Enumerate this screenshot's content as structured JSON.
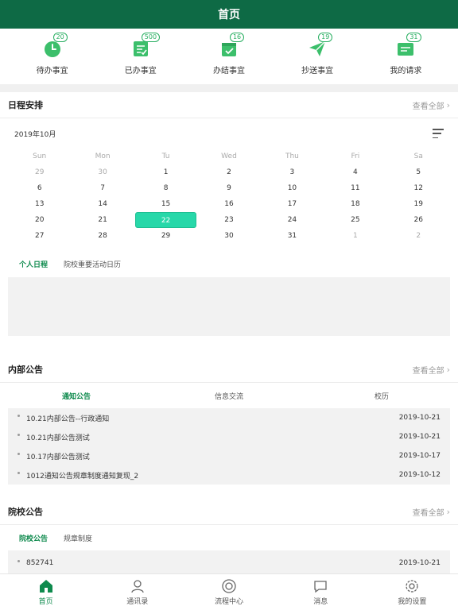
{
  "header": {
    "title": "首页"
  },
  "quick_actions": [
    {
      "label": "待办事宜",
      "badge": "20",
      "icon": "clock-icon"
    },
    {
      "label": "已办事宜",
      "badge": "500",
      "icon": "done-list-icon"
    },
    {
      "label": "办结事宜",
      "badge": "16",
      "icon": "calendar-check-icon"
    },
    {
      "label": "抄送事宜",
      "badge": "19",
      "icon": "send-icon"
    },
    {
      "label": "我的请求",
      "badge": "31",
      "icon": "request-icon"
    }
  ],
  "schedule": {
    "title": "日程安排",
    "more": "查看全部",
    "month": "2019年10月",
    "weekdays": [
      "Sun",
      "Mon",
      "Tu",
      "Wed",
      "Thu",
      "Fri",
      "Sa"
    ],
    "weeks": [
      [
        "29",
        "30",
        "1",
        "2",
        "3",
        "4",
        "5"
      ],
      [
        "6",
        "7",
        "8",
        "9",
        "10",
        "11",
        "12"
      ],
      [
        "13",
        "14",
        "15",
        "16",
        "17",
        "18",
        "19"
      ],
      [
        "20",
        "21",
        "22",
        "23",
        "24",
        "25",
        "26"
      ],
      [
        "27",
        "28",
        "29",
        "30",
        "31",
        "1",
        "2"
      ]
    ],
    "selected_day": "22",
    "tabs": [
      "个人日程",
      "院校重要活动日历"
    ]
  },
  "internal": {
    "title": "内部公告",
    "more": "查看全部",
    "tabs": [
      "通知公告",
      "信息交流",
      "校历"
    ],
    "items": [
      {
        "title": "10.21内部公告--行政通知",
        "date": "2019-10-21"
      },
      {
        "title": "10.21内部公告测试",
        "date": "2019-10-21"
      },
      {
        "title": "10.17内部公告测试",
        "date": "2019-10-17"
      },
      {
        "title": "1012通知公告规章制度通知复现_2",
        "date": "2019-10-12"
      }
    ]
  },
  "school": {
    "title": "院校公告",
    "more": "查看全部",
    "tabs": [
      "院校公告",
      "规章制度"
    ],
    "items": [
      {
        "title": "852741",
        "date": "2019-10-21"
      }
    ]
  },
  "bottom_nav": [
    {
      "label": "首页",
      "icon": "home-icon"
    },
    {
      "label": "通讯录",
      "icon": "contacts-icon"
    },
    {
      "label": "流程中心",
      "icon": "process-icon"
    },
    {
      "label": "消息",
      "icon": "message-icon"
    },
    {
      "label": "我的设置",
      "icon": "settings-icon"
    }
  ],
  "colors": {
    "brand": "#0e6a45",
    "accent": "#27d8a9",
    "active_text": "#0e8a4d"
  }
}
